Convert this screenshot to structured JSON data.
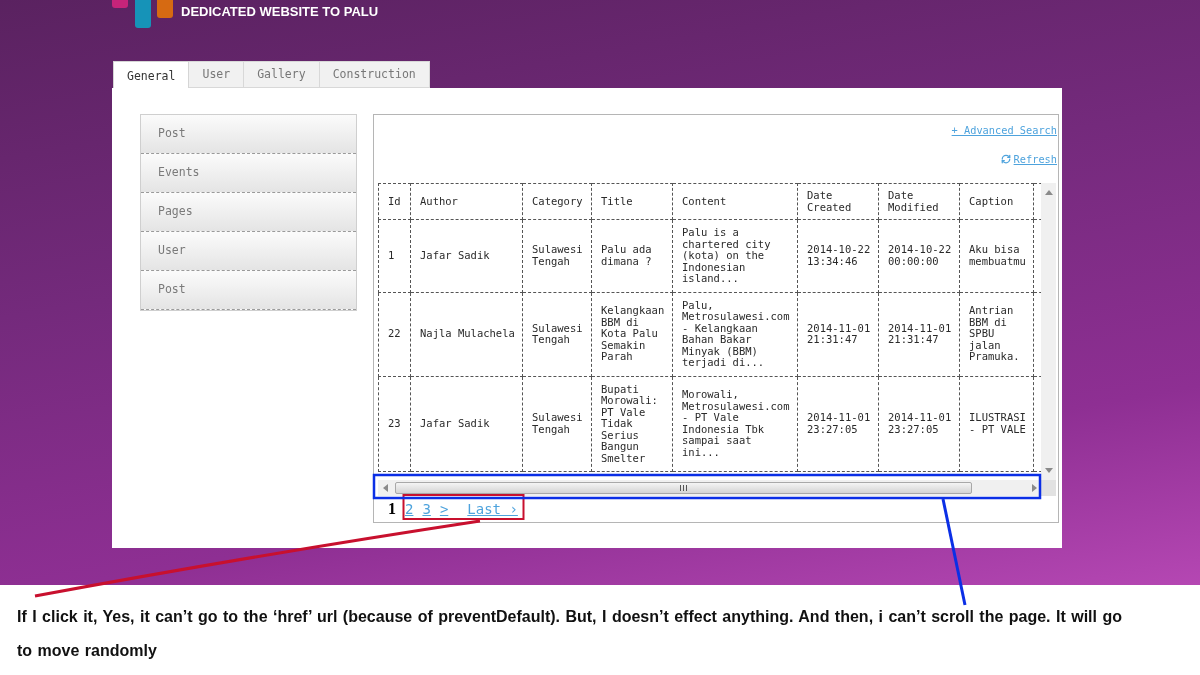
{
  "header": {
    "site_title": "DEDICATED WEBSITE TO PALU"
  },
  "tabs": [
    {
      "label": "General",
      "selected": true
    },
    {
      "label": "User",
      "selected": false
    },
    {
      "label": "Gallery",
      "selected": false
    },
    {
      "label": "Construction",
      "selected": false
    }
  ],
  "sidebar": {
    "items": [
      {
        "label": "Post"
      },
      {
        "label": "Events"
      },
      {
        "label": "Pages"
      },
      {
        "label": "User"
      },
      {
        "label": "Post"
      }
    ]
  },
  "toolbar_links": [
    {
      "kind": "advanced",
      "label": "+ Advanced Search"
    },
    {
      "kind": "refresh",
      "label": "Refresh"
    }
  ],
  "table": {
    "columns": [
      "Id",
      "Author",
      "Category",
      "Title",
      "Content",
      "Date Created",
      "Date Modified",
      "Caption"
    ],
    "rows": [
      [
        "1",
        "Jafar Sadik",
        "Sulawesi Tengah",
        "Palu ada dimana ?",
        "Palu is a chartered city (kota) on the Indonesian island...",
        "2014-10-22 13:34:46",
        "2014-10-22 00:00:00",
        "Aku bisa membuatmu"
      ],
      [
        "22",
        "Najla Mulachela",
        "Sulawesi Tengah",
        "Kelangkaan BBM di Kota Palu Semakin Parah",
        "Palu, Metrosulawesi.com - Kelangkaan Bahan Bakar Minyak (BBM) terjadi di...",
        "2014-11-01 21:31:47",
        "2014-11-01 21:31:47",
        "Antrian BBM di SPBU jalan Pramuka."
      ],
      [
        "23",
        "Jafar Sadik",
        "Sulawesi Tengah",
        "Bupati Morowali: PT Vale Tidak Serius Bangun Smelter",
        "Morowali, Metrosulawesi.com - PT Vale Indonesia Tbk sampai saat ini...",
        "2014-11-01 23:27:05",
        "2014-11-01 23:27:05",
        "ILUSTRASI - PT VALE"
      ]
    ]
  },
  "pagination": [
    {
      "kind": "page",
      "label": "1",
      "selected": true
    },
    {
      "kind": "page",
      "label": "2",
      "selected": false
    },
    {
      "kind": "page",
      "label": "3",
      "selected": false
    },
    {
      "kind": "next",
      "label": ">",
      "selected": false
    },
    {
      "kind": "last",
      "label": "Last ›",
      "selected": false
    }
  ],
  "caption": "If I click it, Yes, it can’t go to the ‘href’ url (because of preventDefault). But, I doesn’t effect anything. And then, i can’t scroll the page. It will go to move randomly"
}
